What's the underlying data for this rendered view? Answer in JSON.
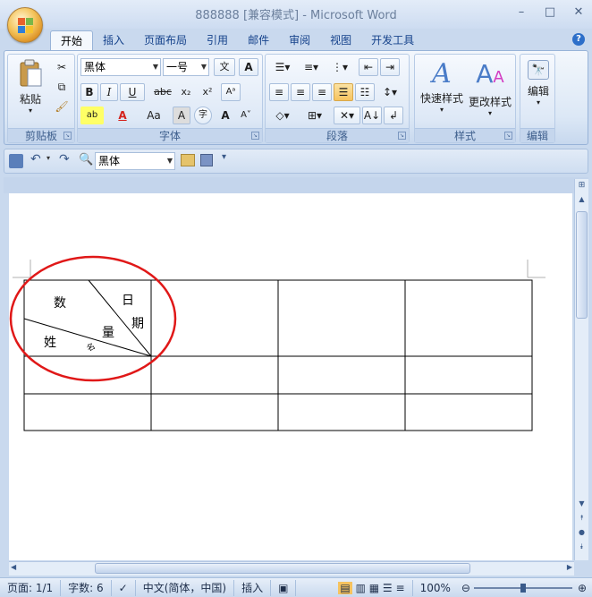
{
  "window": {
    "title": "888888 [兼容模式] - Microsoft Word",
    "controls": [
      "–",
      "□",
      "✕"
    ]
  },
  "tabs": [
    "开始",
    "插入",
    "页面布局",
    "引用",
    "邮件",
    "审阅",
    "视图",
    "开发工具"
  ],
  "ribbon": {
    "clipboard": {
      "label": "剪贴板",
      "paste_label": "粘贴"
    },
    "font": {
      "label": "字体",
      "font_name": "黑体",
      "font_size": "一号",
      "buttons": [
        "B",
        "I",
        "U",
        "abc",
        "x₂",
        "x²",
        "Aa",
        "A",
        "A",
        "A"
      ]
    },
    "paragraph": {
      "label": "段落"
    },
    "styles": {
      "label": "样式",
      "quick_styles": "快速样式",
      "change_styles": "更改样式"
    },
    "editing": {
      "label": "编辑",
      "edit": "编辑"
    }
  },
  "qat": {
    "font_name": "黑体"
  },
  "table": {
    "header_cell": {
      "top_left": "数",
      "bottom_left": "姓",
      "mid": "量",
      "top_right": "日",
      "right": "期",
      "small": "名"
    },
    "rows": 3,
    "cols": 4
  },
  "statusbar": {
    "page": "页面: 1/1",
    "words": "字数: 6",
    "language": "中文(简体，中国)",
    "mode": "插入",
    "zoom": "100%"
  },
  "colors": {
    "accent": "#15428b",
    "annotation_circle": "#e01818",
    "ribbon_border": "#98b3d8"
  }
}
